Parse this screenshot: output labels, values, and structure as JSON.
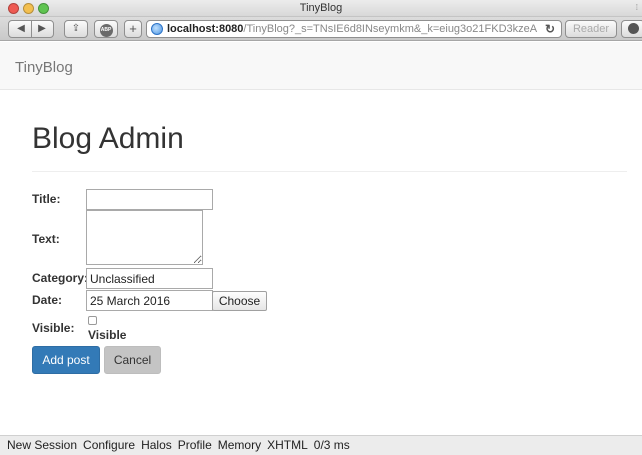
{
  "window": {
    "title": "TinyBlog"
  },
  "browser": {
    "url_host": "localhost:8080",
    "url_rest": "/TinyBlog?_s=TNsIE6d8INseymkm&_k=eiug3o21FKD3kzeA",
    "reader_label": "Reader",
    "abp_label": "ABP"
  },
  "navbar": {
    "brand": "TinyBlog"
  },
  "page": {
    "heading": "Blog Admin"
  },
  "form": {
    "title_label": "Title:",
    "title_value": "",
    "text_label": "Text:",
    "text_value": "",
    "category_label": "Category:",
    "category_value": "Unclassified",
    "date_label": "Date:",
    "date_value": "25 March 2016",
    "choose_label": "Choose",
    "visible_label": "Visible:",
    "visible_checkbox_label": "Visible",
    "visible_checked": false,
    "add_label": "Add post",
    "cancel_label": "Cancel"
  },
  "dev_toolbar": {
    "items": [
      "New Session",
      "Configure",
      "Halos",
      "Profile",
      "Memory",
      "XHTML",
      "0/3 ms"
    ]
  },
  "colors": {
    "primary": "#337ab7",
    "cancel": "#c4c4c4",
    "navbar_bg": "#f8f8f8"
  }
}
